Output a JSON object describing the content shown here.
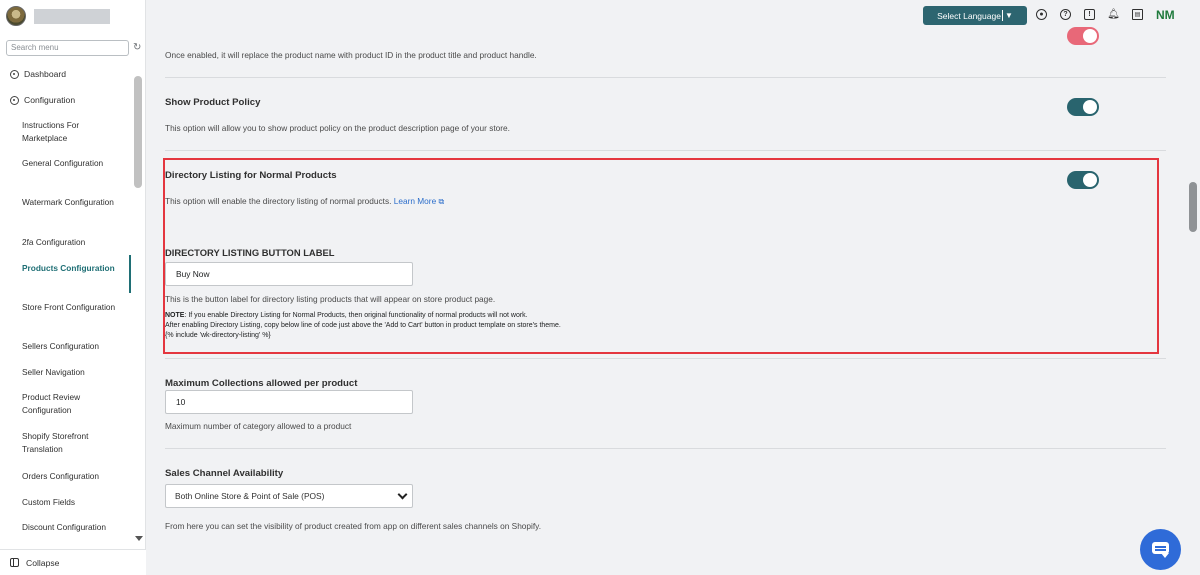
{
  "sidebar": {
    "search_placeholder": "Search menu",
    "dashboard": "Dashboard",
    "configuration": "Configuration",
    "sub_items": [
      "Instructions For Marketplace",
      "General Configuration",
      "Watermark Configuration",
      "2fa Configuration",
      "Products Configuration",
      "Store Front Configuration",
      "Sellers Configuration",
      "Seller Navigation",
      "Product Review Configuration",
      "Shopify Storefront Translation",
      "Orders Configuration",
      "Custom Fields",
      "Discount Configuration"
    ],
    "active_item": "Products Configuration",
    "collapse": "Collapse"
  },
  "topbar": {
    "language_button": "Select Language",
    "initials": "NM"
  },
  "settings": {
    "product_id_desc": "Once enabled, it will replace the product name with product ID in the product title and product handle.",
    "policy_title": "Show Product Policy",
    "policy_desc": "This option will allow you to show product policy on the product description page of your store.",
    "directory_title": "Directory Listing for Normal Products",
    "directory_desc": "This option will enable the directory listing of normal products.",
    "learn_more": "Learn More",
    "button_label_heading": "DIRECTORY LISTING BUTTON LABEL",
    "button_label_value": "Buy Now",
    "button_label_desc": "This is the button label for directory listing products that will appear on store product page.",
    "note_label": "NOTE",
    "note_line1": ": If you enable Directory Listing for Normal Products, then original functionality of normal products will not work.",
    "note_line2": "After enabling Directory Listing, copy below line of code just above the 'Add to Cart' button in product template on store's theme.",
    "note_line3": "{% include 'wk-directory-listing' %}",
    "max_collections_title": "Maximum Collections allowed per product",
    "max_collections_value": "10",
    "max_collections_desc": "Maximum number of category allowed to a product",
    "sales_channel_title": "Sales Channel Availability",
    "sales_channel_value": "Both Online Store & Point of Sale (POS)",
    "sales_channel_desc": "From here you can set the visibility of product created from app on different sales channels on Shopify."
  },
  "toggles": {
    "product_id_enabled": false,
    "policy_enabled": true,
    "directory_enabled": true
  },
  "colors": {
    "toggle_on": "#29646e",
    "toggle_off": "#e86878",
    "highlight_border": "#e4363f",
    "chat_button": "#2f6bd8"
  }
}
